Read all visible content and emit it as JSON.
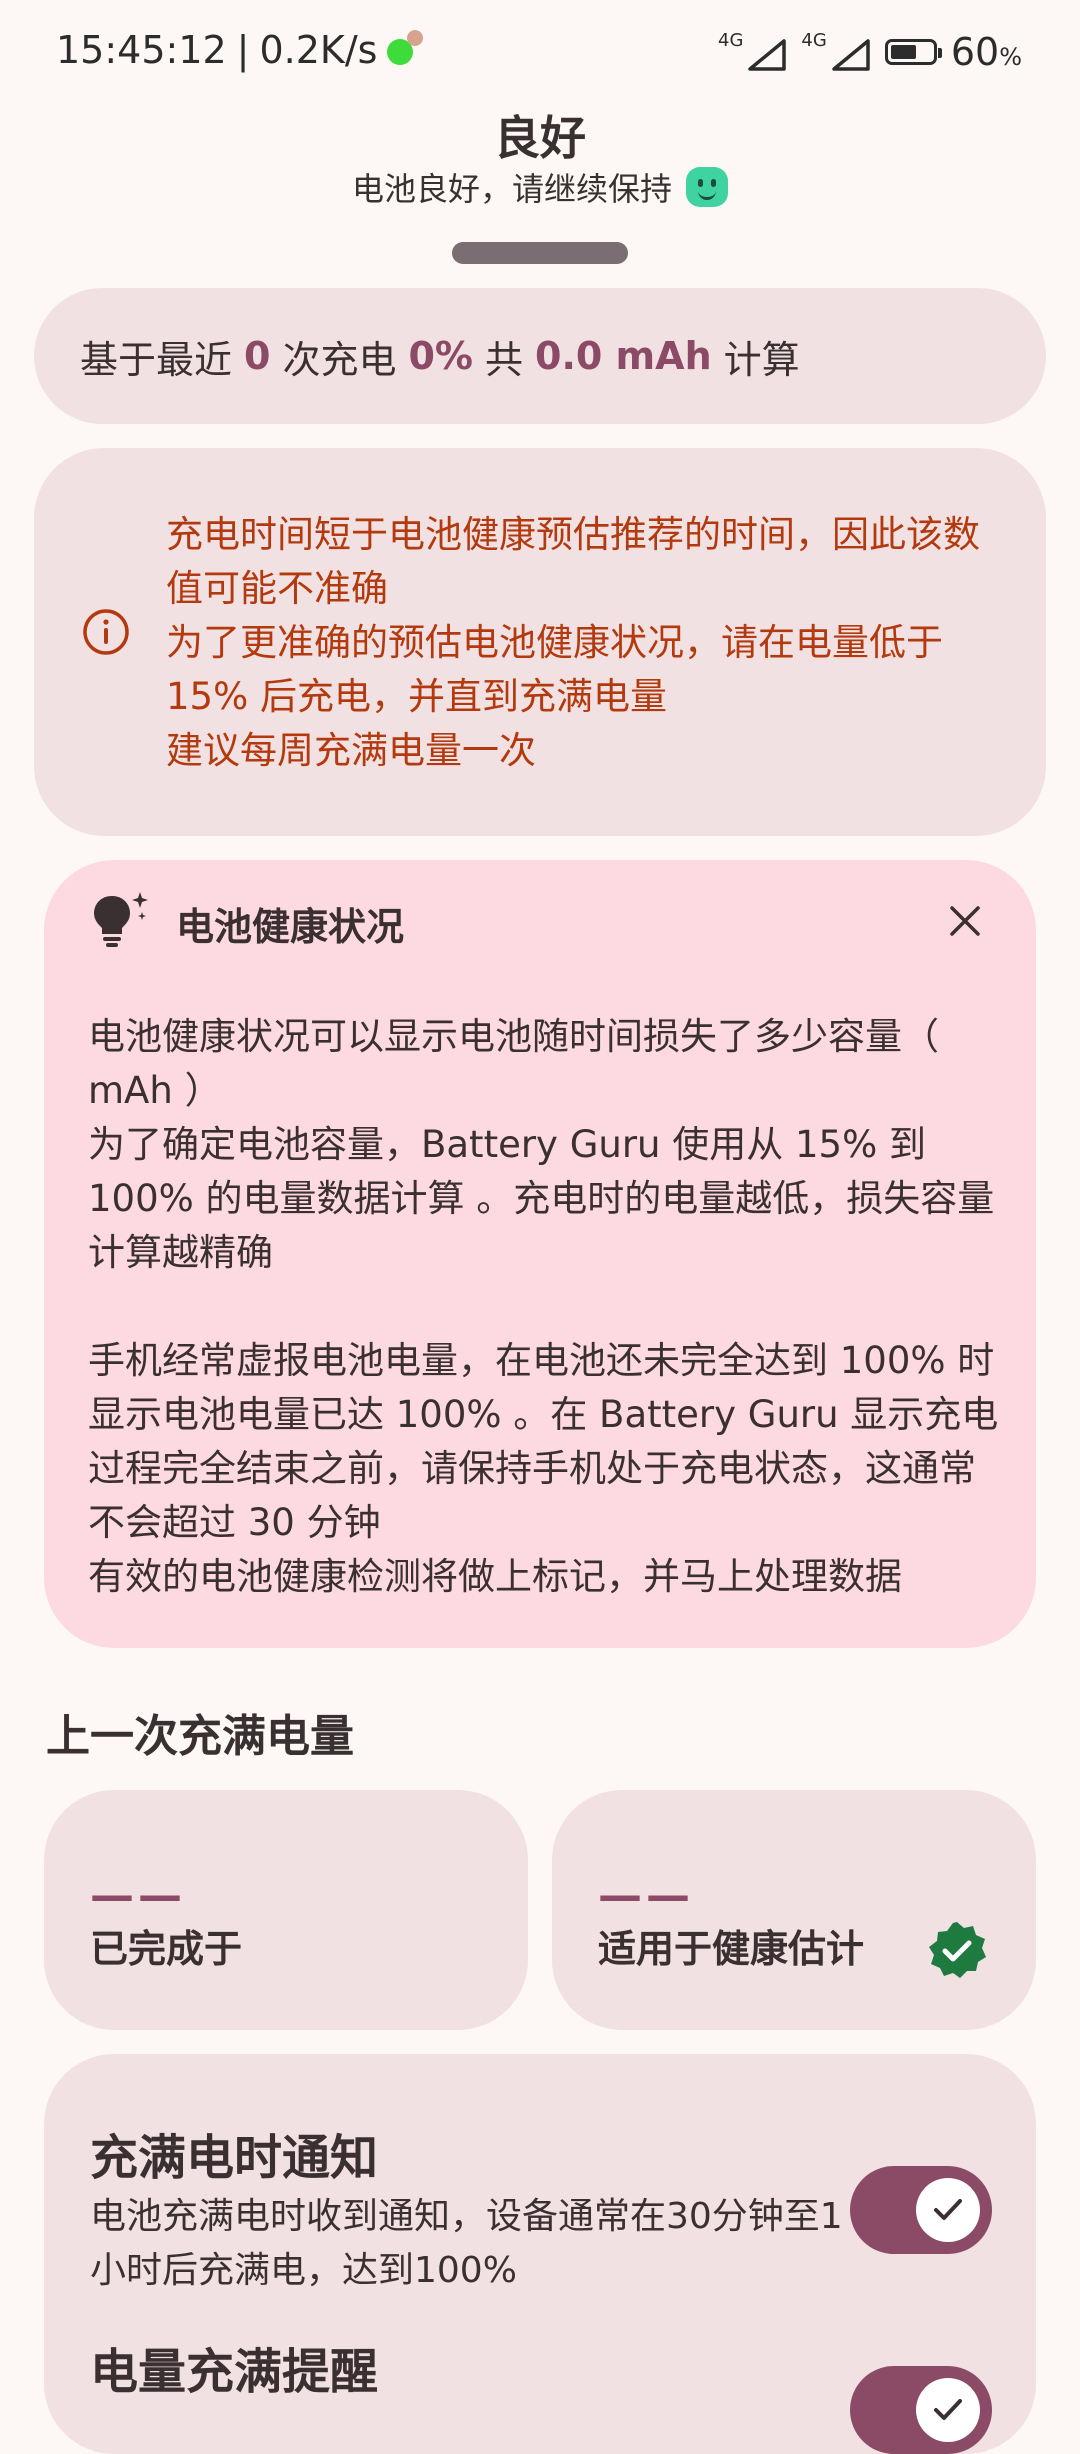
{
  "status_bar": {
    "time": "15:45:12",
    "separator": "|",
    "speed": "0.2K/s",
    "net1": "4G",
    "net2": "4G",
    "battery_pct": "60",
    "battery_unit": "%"
  },
  "header": {
    "title": "良好",
    "subtitle": "电池良好，请继续保持"
  },
  "basis": {
    "prefix": "基于最近",
    "count": "0",
    "mid1": "次充电",
    "percent": "0%",
    "mid2": "共",
    "capacity": "0.0 mAh",
    "suffix": "计算"
  },
  "warning": {
    "lines": [
      "充电时间短于电池健康预估推荐的时间，因此该数值可能不准确",
      "为了更准确的预估电池健康状况，请在电量低于 15% 后充电，并直到充满电量",
      "建议每周充满电量一次"
    ]
  },
  "info_card": {
    "title": "电池健康状况",
    "paragraphs": [
      "电池健康状况可以显示电池随时间损失了多少容量（ mAh ）",
      "为了确定电池容量，Battery Guru 使用从 15% 到 100% 的电量数据计算 。充电时的电量越低，损失容量计算越精确",
      "",
      "手机经常虚报电池电量，在电池还未完全达到 100% 时显示电池电量已达 100% 。在 Battery Guru 显示充电过程完全结束之前，请保持手机处于充电状态，这通常不会超过 30 分钟",
      "有效的电池健康检测将做上标记，并马上处理数据"
    ]
  },
  "last_full_charge": {
    "section_title": "上一次充满电量",
    "completed": {
      "value": "——",
      "label": "已完成于"
    },
    "health": {
      "value": "——",
      "label": "适用于健康估计"
    }
  },
  "settings": {
    "full_notify": {
      "title": "充满电时通知",
      "desc": "电池充满电时收到通知，设备通常在30分钟至1小时后充满电，达到100%",
      "enabled": true
    },
    "full_reminder": {
      "title": "电量充满提醒",
      "enabled": true
    }
  },
  "colors": {
    "accent": "#8B4A66",
    "warning": "#B33A0E",
    "verified": "#1E7A3E",
    "card": "#F2E1E3",
    "info_card": "#FDD9E1"
  }
}
